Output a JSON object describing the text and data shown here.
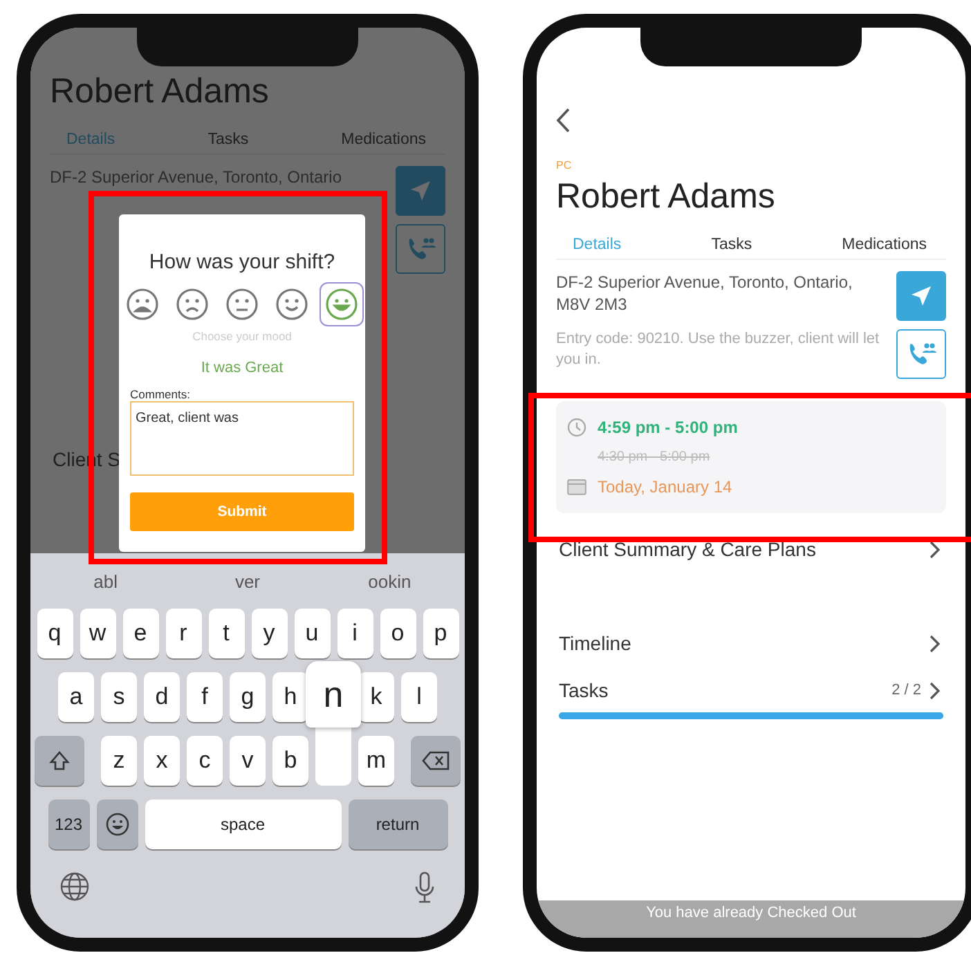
{
  "left_phone": {
    "background": {
      "title": "Robert Adams",
      "tabs": [
        {
          "label": "Details",
          "selected": true
        },
        {
          "label": "Tasks",
          "selected": false
        },
        {
          "label": "Medications",
          "selected": false
        }
      ],
      "address": "DF-2 Superior Avenue, Toronto, Ontario",
      "row_label": "Client S"
    },
    "dialog": {
      "title": "How was your shift?",
      "moods": [
        {
          "kind": "awful",
          "selected": false
        },
        {
          "kind": "sad",
          "selected": false
        },
        {
          "kind": "neutral",
          "selected": false
        },
        {
          "kind": "happy",
          "selected": false
        },
        {
          "kind": "great",
          "selected": true
        }
      ],
      "hint": "Choose your mood",
      "mood_label": "It was Great",
      "comments_label": "Comments:",
      "comments_value": "Great, client was ",
      "submit": "Submit"
    },
    "keyboard": {
      "suggestions": [
        "abl",
        "ver",
        "ookin"
      ],
      "rows": [
        [
          {
            "label": "q",
            "pressed": false
          },
          {
            "label": "w",
            "pressed": false
          },
          {
            "label": "e",
            "pressed": false
          },
          {
            "label": "r",
            "pressed": false
          },
          {
            "label": "t",
            "pressed": false
          },
          {
            "label": "y",
            "pressed": false
          },
          {
            "label": "u",
            "pressed": false
          },
          {
            "label": "i",
            "pressed": false
          },
          {
            "label": "o",
            "pressed": false
          },
          {
            "label": "p",
            "pressed": false
          }
        ],
        [
          {
            "label": "a",
            "pressed": false
          },
          {
            "label": "s",
            "pressed": false
          },
          {
            "label": "d",
            "pressed": false
          },
          {
            "label": "f",
            "pressed": false
          },
          {
            "label": "g",
            "pressed": false
          },
          {
            "label": "h",
            "pressed": false
          },
          {
            "label": "n",
            "pressed": true
          },
          {
            "label": "k",
            "pressed": false
          },
          {
            "label": "l",
            "pressed": false
          }
        ],
        [
          {
            "label": "z",
            "pressed": false
          },
          {
            "label": "x",
            "pressed": false
          },
          {
            "label": "c",
            "pressed": false
          },
          {
            "label": "v",
            "pressed": false
          },
          {
            "label": "b",
            "pressed": false
          },
          {
            "pressed": true
          },
          {
            "label": "m",
            "pressed": false
          }
        ]
      ],
      "numbers_key": "123",
      "space_key": "space",
      "return_key": "return"
    }
  },
  "right_phone": {
    "tag": "PC",
    "title": "Robert Adams",
    "tabs": [
      {
        "label": "Details",
        "selected": true
      },
      {
        "label": "Tasks",
        "selected": false
      },
      {
        "label": "Medications",
        "selected": false
      }
    ],
    "address": "DF-2 Superior Avenue, Toronto, Ontario, M8V 2M3",
    "entry_note": "Entry code: 90210. Use the buzzer, client will let you in.",
    "schedule": {
      "time": "4:59 pm - 5:00 pm",
      "original_time": "4:30 pm - 5:00 pm",
      "date": "Today, January 14"
    },
    "rows": [
      {
        "label": "Client Summary & Care Plans"
      },
      {
        "label": "Timeline"
      },
      {
        "label": "Tasks",
        "count": "2 / 2",
        "level": 1
      }
    ],
    "banner": "You have already Checked Out"
  }
}
